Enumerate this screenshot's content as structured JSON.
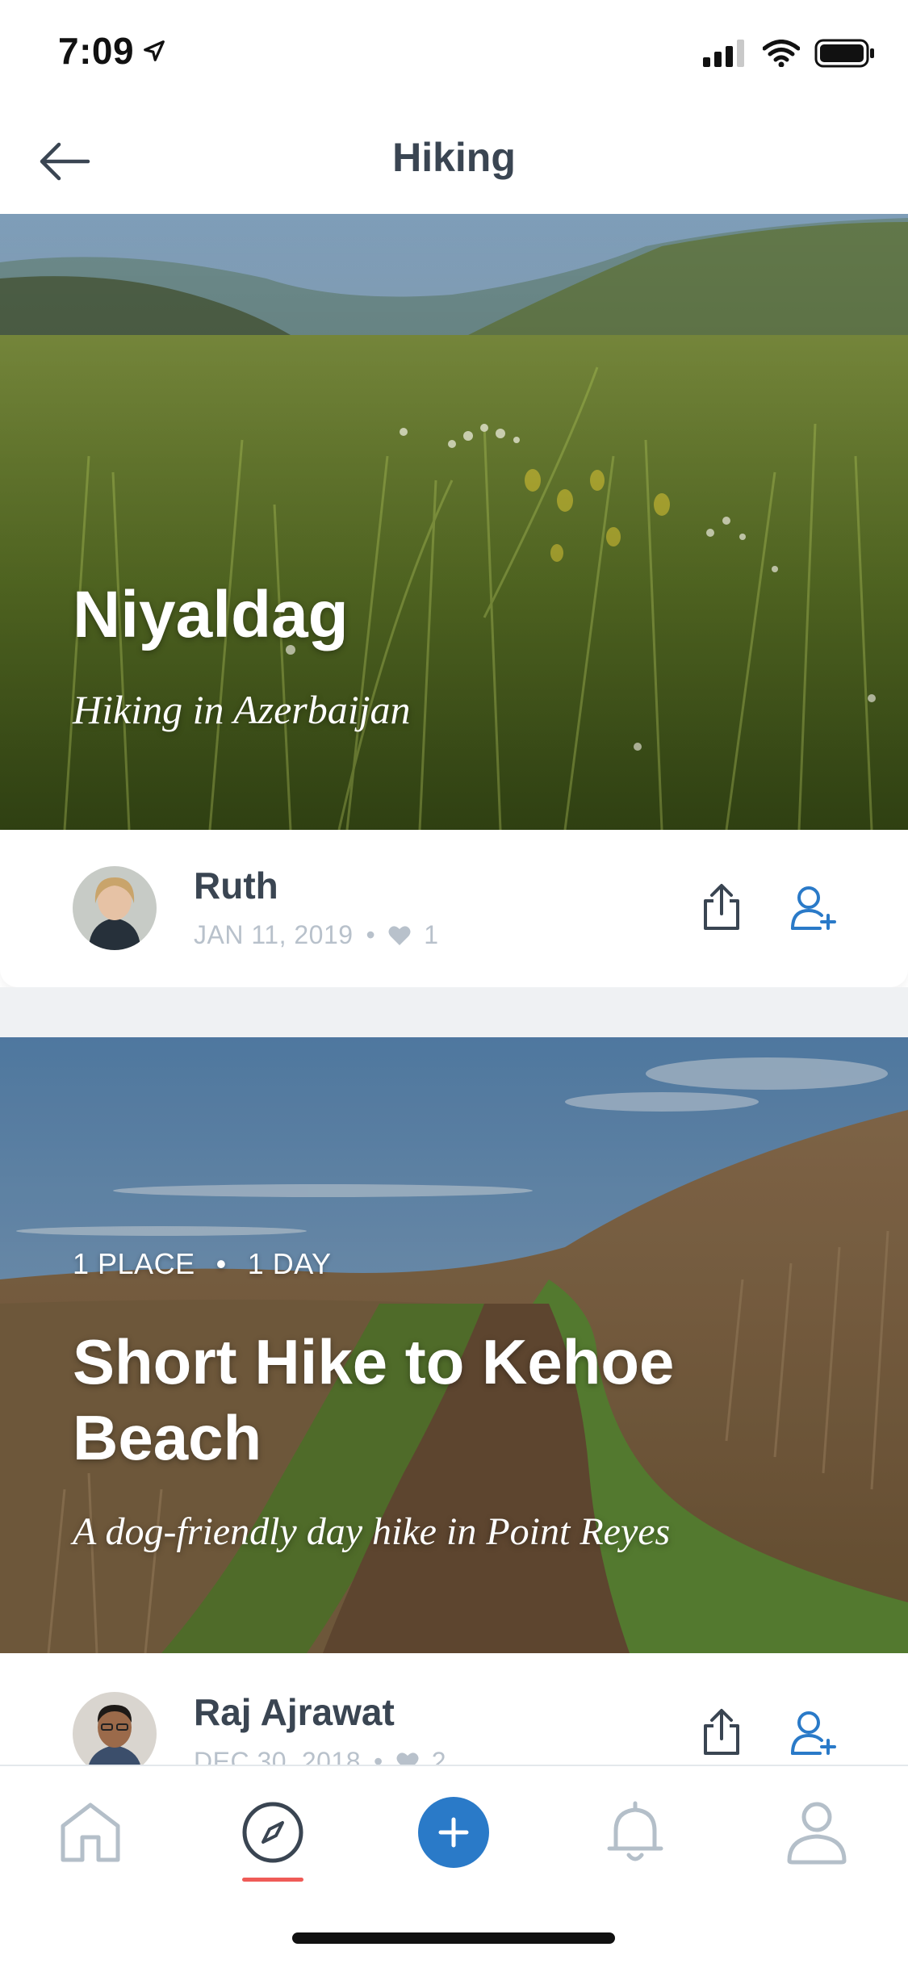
{
  "status_bar": {
    "time": "7:09"
  },
  "header": {
    "title": "Hiking"
  },
  "cards": [
    {
      "title": "Niyaldag",
      "subtitle": "Hiking in Azerbaijan",
      "author": "Ruth",
      "date": "JAN 11, 2019",
      "likes": "1"
    },
    {
      "places": "1 PLACE",
      "days": "1 DAY",
      "title": "Short Hike to Kehoe Beach",
      "subtitle": "A dog-friendly day hike in Point Reyes",
      "author": "Raj Ajrawat",
      "date": "DEC 30, 2018",
      "likes": "2"
    }
  ],
  "tab_bar": {
    "items": [
      "home-icon",
      "compass-icon",
      "plus-icon",
      "bell-icon",
      "person-icon"
    ],
    "active": "compass-icon"
  },
  "colors": {
    "accent_blue": "#2a7ac8",
    "active_indicator": "#ef5b57",
    "text_dark": "#3a4552",
    "text_muted": "#b8c1cb"
  }
}
